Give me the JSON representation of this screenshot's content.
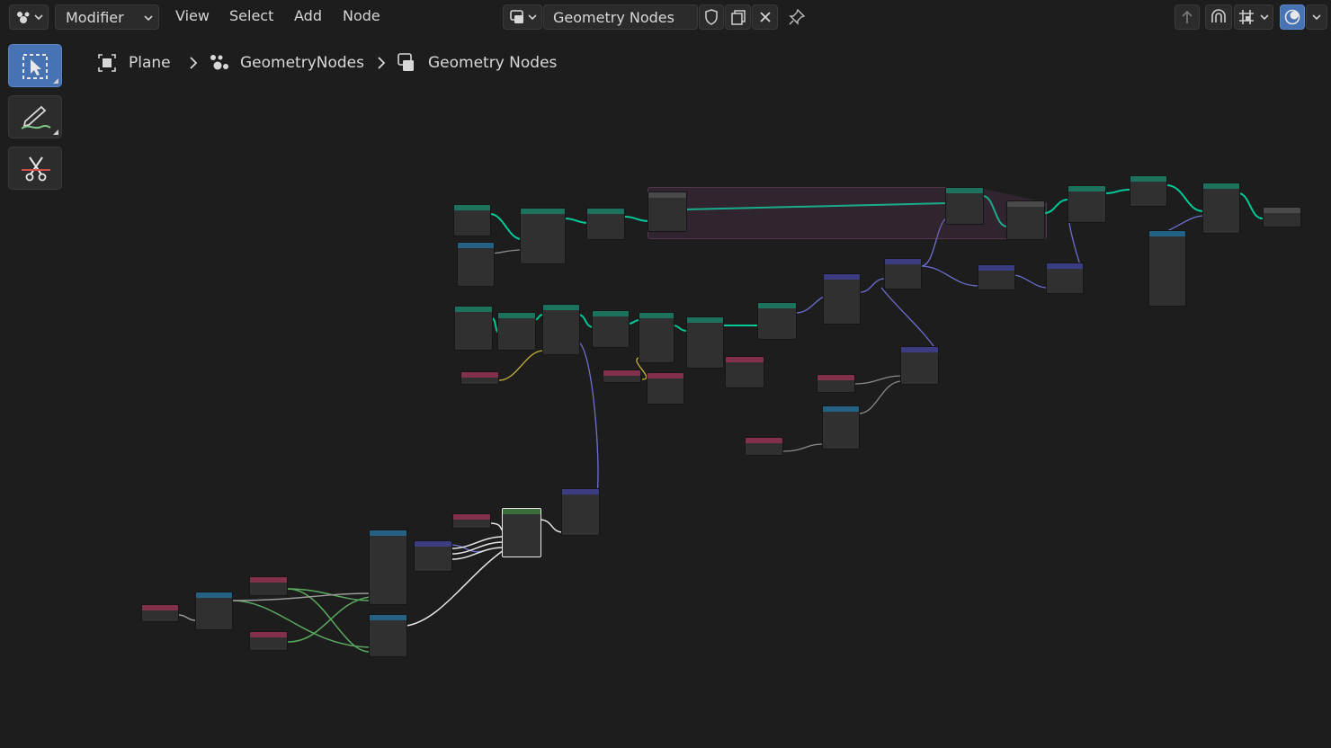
{
  "header": {
    "editor_type": "Modifier",
    "menu": [
      "View",
      "Select",
      "Add",
      "Node"
    ],
    "node_tree_name": "Geometry Nodes"
  },
  "breadcrumb": {
    "object": "Plane",
    "modifier": "GeometryNodes",
    "node_group": "Geometry Nodes"
  },
  "colors": {
    "background": "#1d1d1d",
    "geometry_link": "#00d6a3",
    "accent_active": "#4772b3",
    "header_geometry": "#1d725e",
    "header_input": "#83314a",
    "header_vector": "#3c3c83",
    "header_utility": "#246283",
    "frame": "#784670"
  },
  "icons": [
    "editor-type-icon",
    "node-tree-icon",
    "fake-user-shield-icon",
    "duplicate-icon",
    "close-icon",
    "pin-icon",
    "parent-arrow-icon",
    "snap-icon",
    "grid-icon",
    "overlay-icon",
    "select-box-icon",
    "annotate-icon",
    "cut-links-icon"
  ]
}
